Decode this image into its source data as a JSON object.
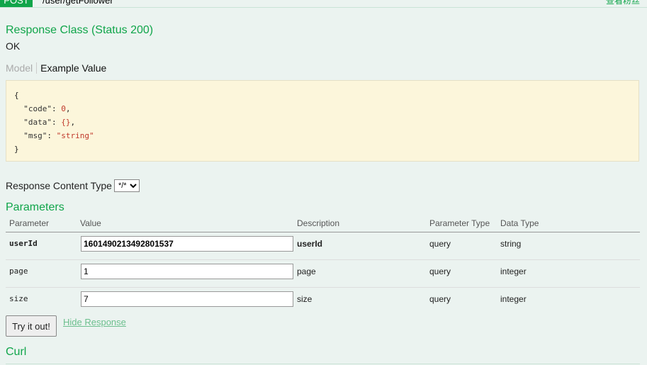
{
  "top": {
    "method": "POST",
    "path": "/user/getFollower",
    "description": "查看粉丝"
  },
  "response_class": {
    "title": "Response Class (Status 200)",
    "text": "OK"
  },
  "model_tabs": {
    "model_label": "Model",
    "example_label": "Example Value"
  },
  "example_value": {
    "open": "{",
    "lines": [
      {
        "key": "\"code\"",
        "sep": ": ",
        "val": "0",
        "tail": ","
      },
      {
        "key": "\"data\"",
        "sep": ": ",
        "val": "{}",
        "tail": ","
      },
      {
        "key": "\"msg\"",
        "sep": ": ",
        "val": "\"string\"",
        "tail": ""
      }
    ],
    "close": "}"
  },
  "response_content_type": {
    "label": "Response Content Type",
    "selected": "*/*"
  },
  "parameters": {
    "title": "Parameters",
    "headers": {
      "parameter": "Parameter",
      "value": "Value",
      "description": "Description",
      "parameter_type": "Parameter Type",
      "data_type": "Data Type"
    },
    "rows": [
      {
        "name": "userId",
        "value": "1601490213492801537",
        "description": "userId",
        "param_type": "query",
        "data_type": "string",
        "required": true
      },
      {
        "name": "page",
        "value": "1",
        "description": "page",
        "param_type": "query",
        "data_type": "integer",
        "required": false
      },
      {
        "name": "size",
        "value": "7",
        "description": "size",
        "param_type": "query",
        "data_type": "integer",
        "required": false
      }
    ]
  },
  "actions": {
    "try_label": "Try it out!",
    "hide_response_label": "Hide Response"
  },
  "curl": {
    "title": "Curl"
  }
}
